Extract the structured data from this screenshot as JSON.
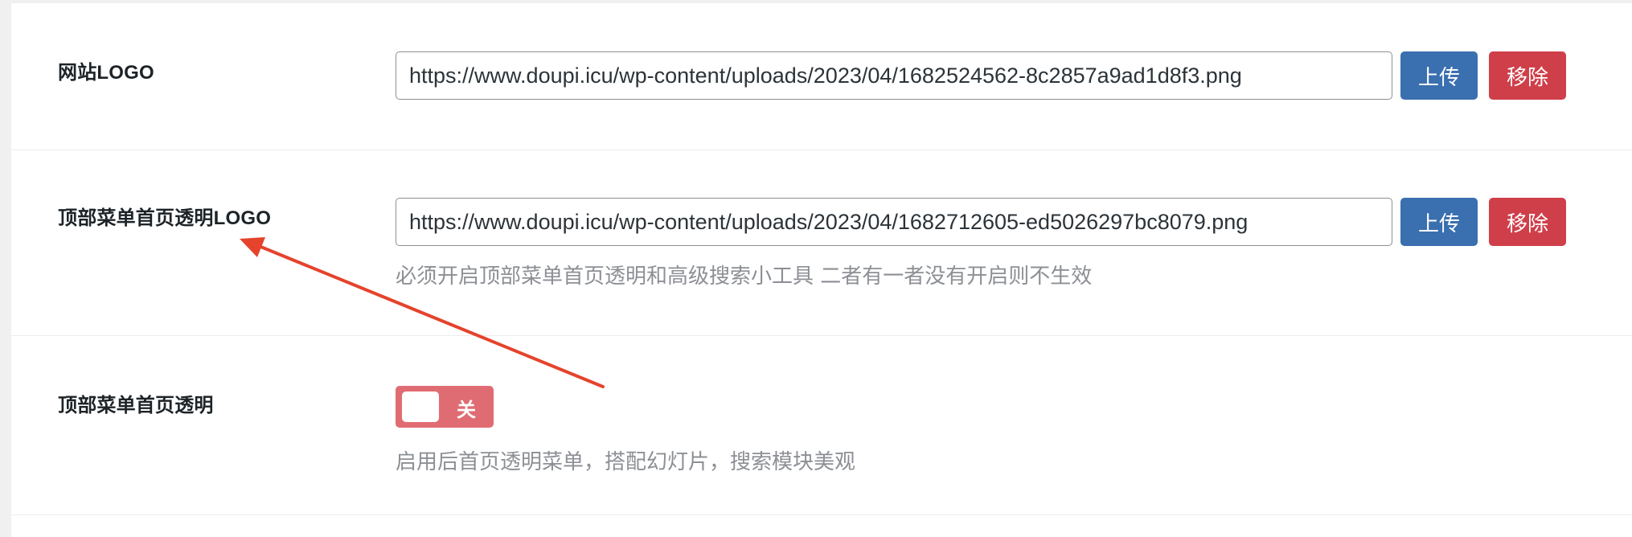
{
  "settings": {
    "site_logo": {
      "label": "网站LOGO",
      "value": "https://www.doupi.icu/wp-content/uploads/2023/04/1682524562-8c2857a9ad1d8f3.png",
      "upload_label": "上传",
      "remove_label": "移除"
    },
    "transparent_logo": {
      "label": "顶部菜单首页透明LOGO",
      "value": "https://www.doupi.icu/wp-content/uploads/2023/04/1682712605-ed5026297bc8079.png",
      "upload_label": "上传",
      "remove_label": "移除",
      "description": "必须开启顶部菜单首页透明和高级搜索小工具 二者有一者没有开启则不生效"
    },
    "transparent_menu": {
      "label": "顶部菜单首页透明",
      "toggle_text": "关",
      "enabled": false,
      "description": "启用后首页透明菜单，搭配幻灯片，搜索模块美观"
    }
  },
  "colors": {
    "upload_button": "#3a6fb0",
    "remove_button": "#cf3f4a",
    "toggle_off": "#e06c73",
    "annotation_arrow": "#e5432c"
  },
  "icons": {
    "annotation": "red-arrow-icon"
  }
}
